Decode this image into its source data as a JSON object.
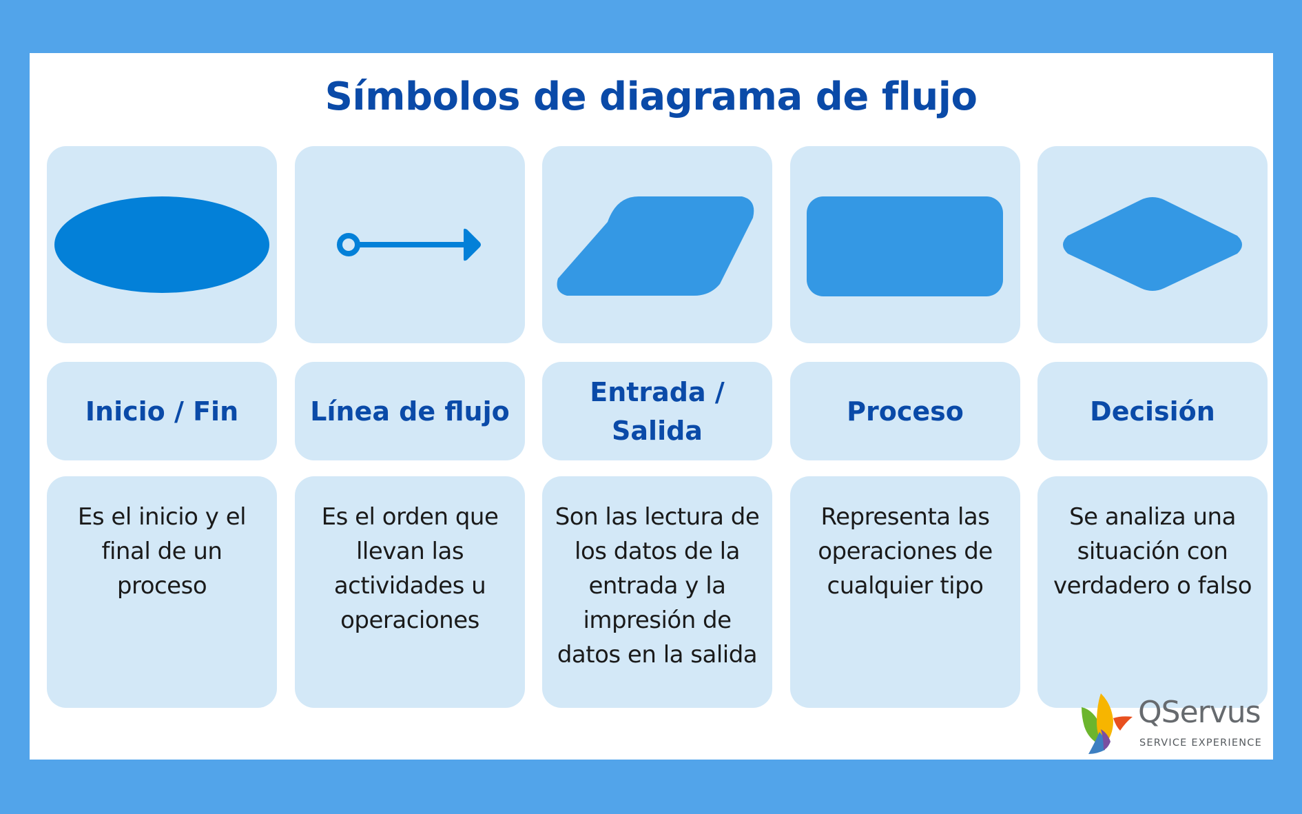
{
  "title": "Símbolos de diagrama de flujo",
  "colors": {
    "background": "#52a4ea",
    "panel": "#ffffff",
    "card": "#d3e8f7",
    "title": "#0a4aa8",
    "ellipse": "#0380d8",
    "shape": "#3498e4",
    "text": "#1a1a1a"
  },
  "symbols": [
    {
      "icon": "ellipse-icon",
      "label": "Inicio / Fin",
      "description": "Es el inicio y el final de un proceso"
    },
    {
      "icon": "arrow-icon",
      "label": "Línea de flujo",
      "description": "Es el orden que llevan las actividades u operaciones"
    },
    {
      "icon": "parallelogram-icon",
      "label": "Entrada / Salida",
      "description": "Son las lectura de los datos de la entrada y la impresión de datos en la salida"
    },
    {
      "icon": "rectangle-icon",
      "label": "Proceso",
      "description": "Representa las operaciones de cualquier tipo"
    },
    {
      "icon": "diamond-icon",
      "label": "Decisión",
      "description": "Se analiza una situación con verdadero o falso"
    }
  ],
  "logo": {
    "name": "QServus",
    "tagline": "SERVICE EXPERIENCE"
  }
}
